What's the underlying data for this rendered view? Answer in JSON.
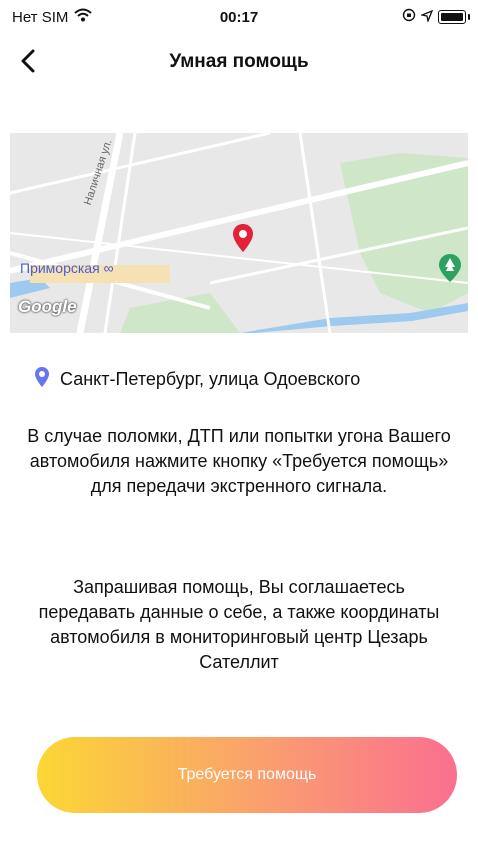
{
  "status_bar": {
    "carrier": "Нет SIM",
    "time": "00:17"
  },
  "header": {
    "title": "Умная помощь"
  },
  "map": {
    "station_label": "Приморская",
    "street_label": "Наличная ул.",
    "logo": "Google",
    "pin_color": "#e32237",
    "park_icon_color": "#2ea060"
  },
  "address": {
    "text": "Санкт-Петербург, улица Одоевского",
    "pin_color": "#6577ea"
  },
  "info": {
    "paragraph1": "В случае поломки, ДТП или попытки угона Вашего автомобиля нажмите кнопку «Требуется помощь» для передачи экстренного сигнала.",
    "paragraph2": "Запрашивая помощь, Вы соглашаетесь передавать данные о себе, а также координаты автомобиля в мониторинговый центр Цезарь Сателлит"
  },
  "action": {
    "help_button_label": "Требуется помощь",
    "gradient": [
      "#fbd735",
      "#fa9e6f",
      "#fb6f90"
    ]
  }
}
